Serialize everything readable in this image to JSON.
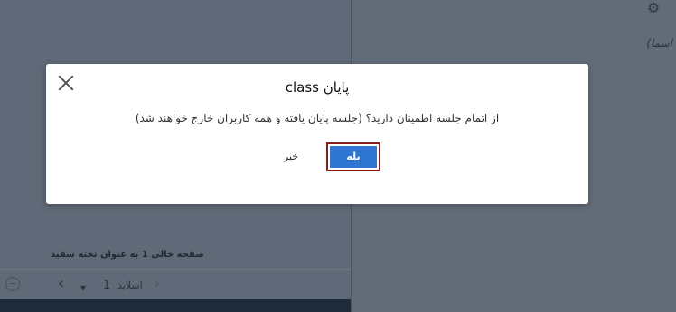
{
  "background": {
    "names_label": "اسما)",
    "white_page_label": "صفحه خالی 1 به عنوان تخته سفید",
    "slide_number": "1",
    "slide_label": "اسلاید"
  },
  "dialog": {
    "title": "پایان class",
    "message": "از اتمام جلسه اطمینان دارید؟ (جلسه پایان یافته و همه کاربران خارج خواهند شد)",
    "no_label": "خیر",
    "yes_label": "بله"
  },
  "colors": {
    "primary_button": "#2f76d2",
    "focus_border": "#8b1a1a"
  }
}
